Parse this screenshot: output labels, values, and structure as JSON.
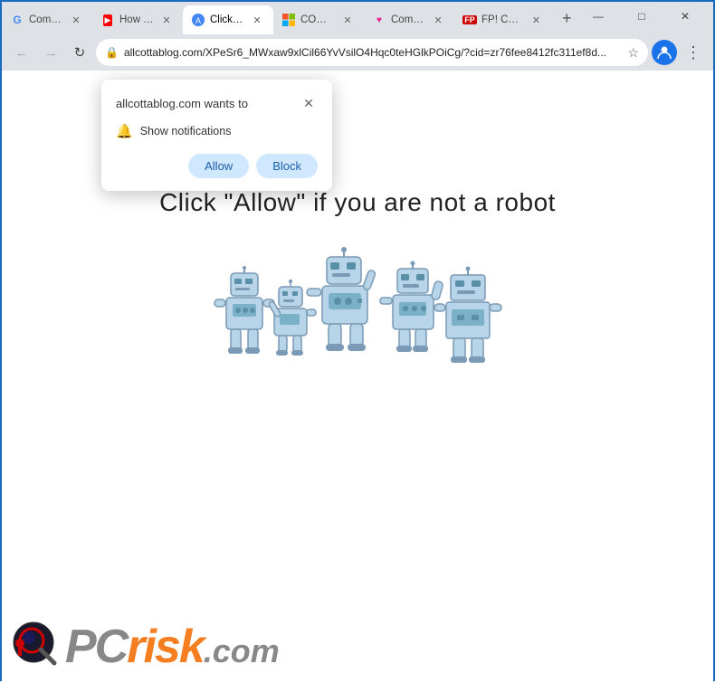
{
  "browser": {
    "tabs": [
      {
        "id": "tab-1",
        "label": "Comb…",
        "active": false,
        "favicon": "G",
        "favicon_type": "google"
      },
      {
        "id": "tab-2",
        "label": "How T…",
        "active": false,
        "favicon": "▶",
        "favicon_type": "youtube"
      },
      {
        "id": "tab-3",
        "label": "Click A…",
        "active": true,
        "favicon": "✓",
        "favicon_type": "active"
      },
      {
        "id": "tab-4",
        "label": "COMP…",
        "active": false,
        "favicon": "⊞",
        "favicon_type": "ms"
      },
      {
        "id": "tab-5",
        "label": "Comb…",
        "active": false,
        "favicon": "♥",
        "favicon_type": "combo"
      },
      {
        "id": "tab-6",
        "label": "FP! Comb…",
        "active": false,
        "favicon": "FP!",
        "favicon_type": "fp"
      }
    ],
    "new_tab_label": "+",
    "window_controls": {
      "minimize": "—",
      "maximize": "□",
      "close": "✕"
    },
    "address_bar": {
      "url": "allcottablog.com/XPeSr6_MWxaw9xlCil66YvVsilO4Hqc0teHGlkPOiCg/?cid=zr76fee8412fc311ef8d...",
      "lock_icon": "🔒"
    },
    "nav": {
      "back": "←",
      "forward": "→",
      "reload": "↻"
    }
  },
  "notification_popup": {
    "title": "allcottablog.com wants to",
    "close_icon": "✕",
    "notification_label": "Show notifications",
    "allow_label": "Allow",
    "block_label": "Block"
  },
  "page": {
    "main_text": "Click \"Allow\"   if you are not   a robot"
  },
  "pcrisk": {
    "pc_text": "PC",
    "risk_text": "risk",
    "dotcom_text": ".com"
  }
}
